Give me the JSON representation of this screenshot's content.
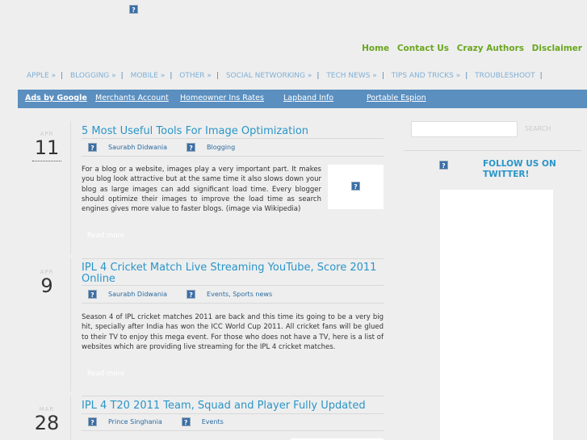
{
  "header": {
    "top_links": [
      "Home",
      "Contact Us",
      "Crazy Authors",
      "Disclaimer"
    ]
  },
  "categories": [
    "APPLE »",
    "BLOGGING »",
    "MOBILE »",
    "OTHER »",
    "SOCIAL NETWORKING »",
    "TECH NEWS »",
    "TIPS AND TRICKS »",
    "TROUBLESHOOT"
  ],
  "ads": {
    "label": "Ads by Google",
    "links": [
      "Merchants Account",
      "Homeowner Ins Rates",
      "Lapband Info",
      "Portable Espion"
    ]
  },
  "posts": [
    {
      "month": "APR",
      "day": "11",
      "title": "5 Most Useful Tools For Image Optimization",
      "author": "Saurabh Didwania",
      "category": "Blogging",
      "excerpt": "For a blog or a website, images play a very important part. It makes you blog look attractive but at the same time it also slows down your blog as large images can add significant load time. Every blogger should optimize their images to improve the load time as search engines gives more value to faster blogs. (image via Wikipedia)",
      "read_more": "Read more"
    },
    {
      "month": "APR",
      "day": "9",
      "title": "IPL 4 Cricket Match Live Streaming YouTube, Score 2011 Online",
      "author": "Saurabh Didwania",
      "category": "Events, Sports news",
      "excerpt": "Season 4 of IPL cricket matches 2011 are back and this time its going to be a very big hit, specially after India has won the ICC World Cup 2011. All cricket fans will be glued to their TV to enjoy this mega event. For those who does not have a TV, here is a list of websites which are providing live streaming for the IPL 4 cricket matches.",
      "read_more": "Read more"
    },
    {
      "month": "MAR",
      "day": "28",
      "title": "IPL 4 T20 2011 Team, Squad and Player Fully Updated",
      "author": "Prince Singhania",
      "category": "Events"
    }
  ],
  "sidebar": {
    "search_button": "SEARCH",
    "follow_line1": "FOLLOW US ON",
    "follow_line2": "TWITTER!"
  },
  "icons": {
    "broken_image": "?"
  }
}
